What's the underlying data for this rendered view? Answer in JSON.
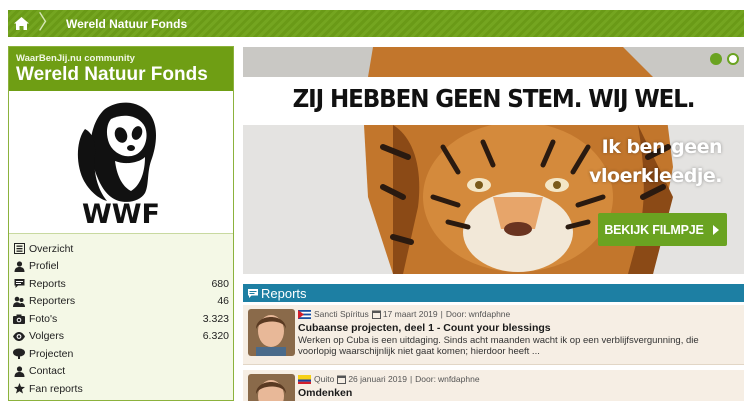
{
  "breadcrumb": {
    "home_icon": "home-icon",
    "current": "Wereld Natuur Fonds"
  },
  "sidebar": {
    "community_label": "WaarBenJij.nu community",
    "title": "Wereld Natuur Fonds",
    "logo_text": "WWF",
    "nav": [
      {
        "icon": "list-icon",
        "label": "Overzicht",
        "count": ""
      },
      {
        "icon": "user-icon",
        "label": "Profiel",
        "count": ""
      },
      {
        "icon": "comment-icon",
        "label": "Reports",
        "count": "680"
      },
      {
        "icon": "users-icon",
        "label": "Reporters",
        "count": "46"
      },
      {
        "icon": "camera-icon",
        "label": "Foto's",
        "count": "3.323"
      },
      {
        "icon": "eye-icon",
        "label": "Volgers",
        "count": "6.320"
      },
      {
        "icon": "tree-icon",
        "label": "Projecten",
        "count": ""
      },
      {
        "icon": "contact-icon",
        "label": "Contact",
        "count": ""
      },
      {
        "icon": "star-icon",
        "label": "Fan reports",
        "count": ""
      }
    ]
  },
  "banner": {
    "slogan": "ZIJ HEBBEN GEEN STEM. WIJ WEL.",
    "side_text_line1": "Ik ben geen",
    "side_text_line2": "vloerkleedje.",
    "cta_label": "BEKIJK FILMPJE",
    "colors": {
      "dot_active": "#6aa321",
      "dot_inactive": "#ffffff",
      "cta": "#6aa321"
    }
  },
  "reports": {
    "heading": "Reports",
    "items": [
      {
        "place": "Sancti Spíritus",
        "date": "17 maart 2019",
        "author_prefix": "Door:",
        "author": "wnfdaphne",
        "title": "Cubaanse projecten, deel 1 - Count your blessings",
        "excerpt": "Werken op Cuba is een uitdaging. Sinds acht maanden wacht ik op een verblijfsvergunning, die voorlopig waarschijnlijk niet gaat komen; hierdoor heeft ..."
      },
      {
        "place": "Quito",
        "date": "26 januari 2019",
        "author_prefix": "Door:",
        "author": "wnfdaphne",
        "title": "Omdenken",
        "excerpt": ""
      }
    ]
  },
  "colors": {
    "brand_green": "#6f9e14",
    "reports_blue": "#1d7fa3",
    "report_bg": "#f6eee4"
  }
}
